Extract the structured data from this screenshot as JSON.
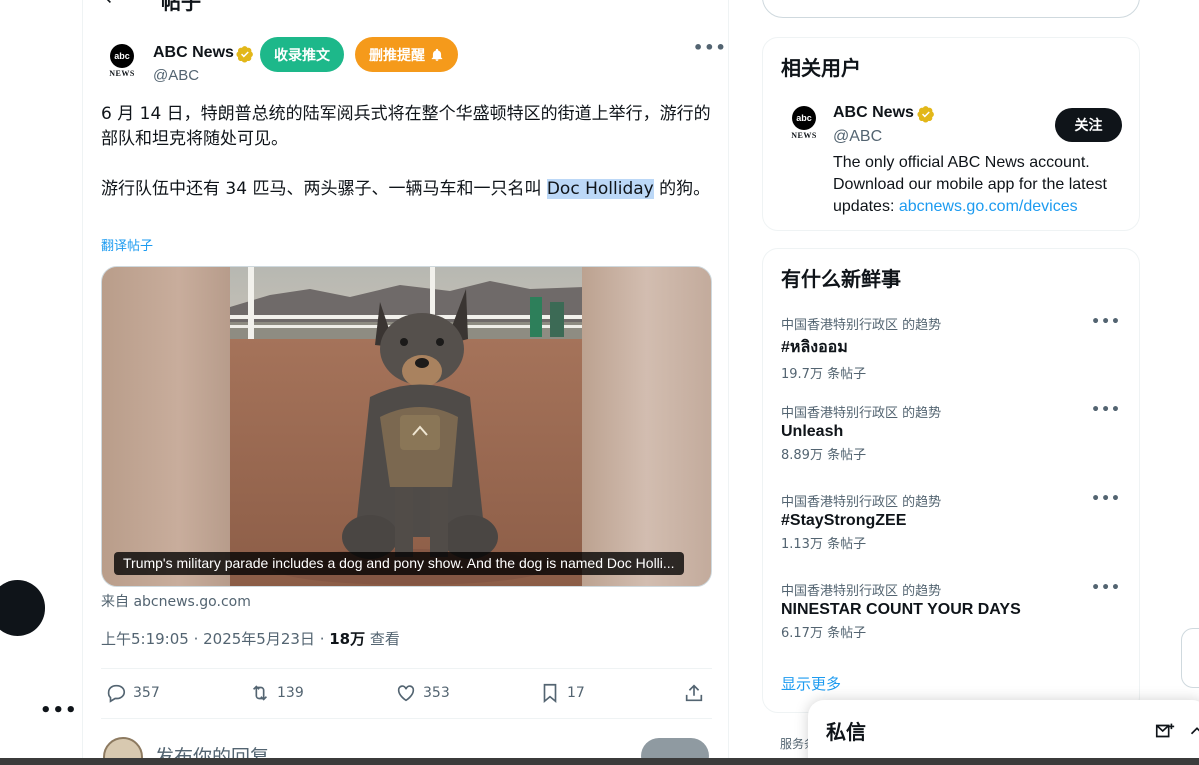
{
  "header": {
    "title": "帖子",
    "back_icon": "arrow-left-icon"
  },
  "tweet": {
    "author": {
      "name": "ABC News",
      "handle": "@ABC",
      "avatar_text": "abc",
      "avatar_sub": "NEWS",
      "verified": true,
      "verified_color": "#e2b719"
    },
    "extension_buttons": {
      "collect": "收录推文",
      "delete_reminder": "删推提醒"
    },
    "text": {
      "para1": "6 月 14 日，特朗普总统的陆军阅兵式将在整个华盛顿特区的街道上举行，游行的部队和坦克将随处可见。",
      "para2_before": "游行队伍中还有 34 匹马、两头骡子、一辆马车和一只名叫 ",
      "para2_highlight": "Doc Holliday",
      "para2_after": " 的狗。"
    },
    "translate_label": "翻译帖子",
    "media": {
      "caption": "Trump's military parade includes a dog and pony show. And the dog is named Doc Holli..."
    },
    "source": "来自 abcnews.go.com",
    "timestamp": {
      "time": "上午5:19:05 · 2025年5月23日 · ",
      "views": "18万",
      "views_label": " 查看"
    },
    "actions": {
      "replies": "357",
      "retweets": "139",
      "likes": "353",
      "bookmarks": "17"
    },
    "reply_placeholder": "发布你的回复"
  },
  "related_users": {
    "title": "相关用户",
    "user": {
      "name": "ABC News",
      "handle": "@ABC",
      "bio": "The only official ABC News account. Download our mobile app for the latest updates: ",
      "bio_link": "abcnews.go.com/devices",
      "follow_label": "关注"
    }
  },
  "trends": {
    "title": "有什么新鲜事",
    "items": [
      {
        "context": "中国香港特别行政区 的趋势",
        "name": "#หลิงออม",
        "count": "19.7万 条帖子"
      },
      {
        "context": "中国香港特别行政区 的趋势",
        "name": "Unleash",
        "count": "8.89万 条帖子"
      },
      {
        "context": "中国香港特别行政区 的趋势",
        "name": "#StayStrongZEE",
        "count": "1.13万 条帖子"
      },
      {
        "context": "中国香港特别行政区 的趋势",
        "name": "NINESTAR COUNT YOUR DAYS",
        "count": "6.17万 条帖子"
      }
    ],
    "show_more": "显示更多"
  },
  "footer": {
    "terms_partial": "服务条"
  },
  "messages_drawer": {
    "title": "私信"
  },
  "colors": {
    "accent": "#1d9bf0",
    "collect_btn": "#1db88a",
    "delete_btn": "#f59a1b"
  }
}
